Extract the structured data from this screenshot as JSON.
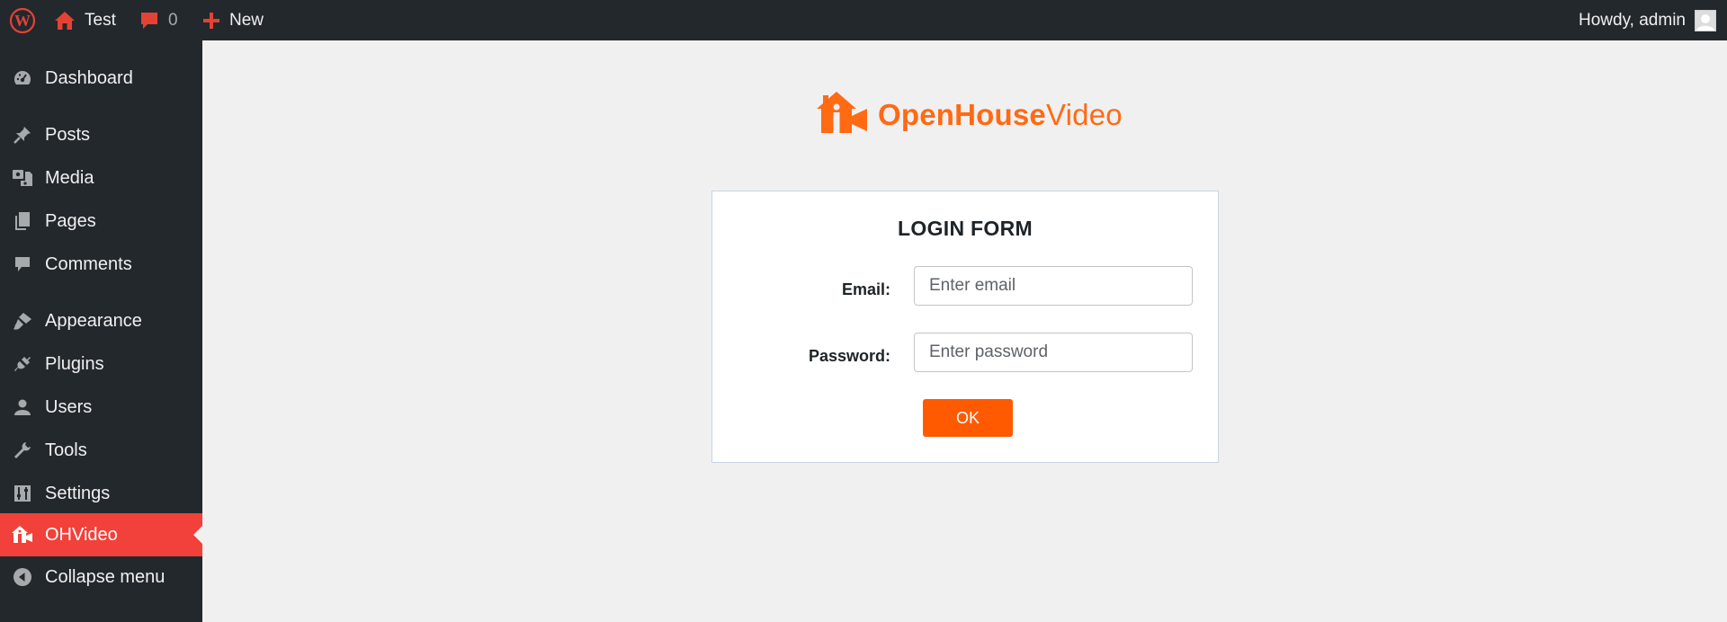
{
  "adminbar": {
    "site_name": "Test",
    "comment_count": "0",
    "new_label": "New",
    "howdy": "Howdy, admin"
  },
  "sidebar": {
    "items": [
      {
        "label": "Dashboard",
        "icon": "dashboard-icon"
      },
      {
        "label": "Posts",
        "icon": "pin-icon"
      },
      {
        "label": "Media",
        "icon": "media-icon"
      },
      {
        "label": "Pages",
        "icon": "pages-icon"
      },
      {
        "label": "Comments",
        "icon": "comment-icon"
      },
      {
        "label": "Appearance",
        "icon": "brush-icon"
      },
      {
        "label": "Plugins",
        "icon": "plugin-icon"
      },
      {
        "label": "Users",
        "icon": "user-icon"
      },
      {
        "label": "Tools",
        "icon": "wrench-icon"
      },
      {
        "label": "Settings",
        "icon": "sliders-icon"
      },
      {
        "label": "OHVideo",
        "icon": "house-video-icon",
        "active": true
      },
      {
        "label": "Collapse menu",
        "icon": "collapse-icon"
      }
    ]
  },
  "logo": {
    "bold": "OpenHouse",
    "light": "Video"
  },
  "form": {
    "title": "LOGIN FORM",
    "email_label": "Email:",
    "email_placeholder": "Enter email",
    "email_value": "",
    "password_label": "Password:",
    "password_placeholder": "Enter password",
    "password_value": "",
    "submit_label": "OK"
  },
  "colors": {
    "adminbar_bg": "#23282d",
    "active_menu": "#f1413a",
    "brand_orange": "#ff6a13",
    "button_orange": "#ff5a00",
    "notification_red": "#e34234"
  }
}
